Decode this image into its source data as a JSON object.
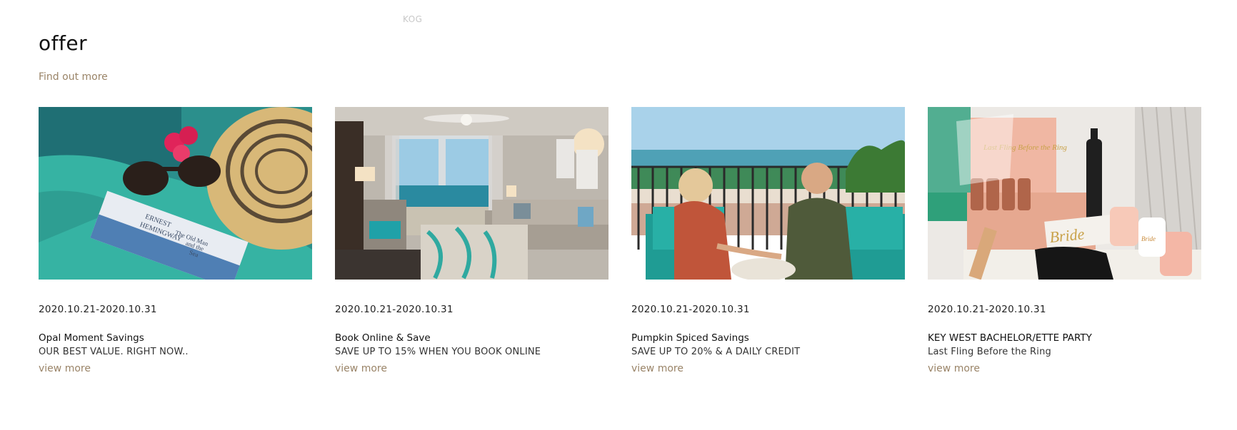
{
  "header": {
    "top_label": "KOG",
    "section_title": "offer",
    "find_more": "Find out more"
  },
  "offers": [
    {
      "date": "2020.10.21-2020.10.31",
      "title": "Opal Moment Savings",
      "subtitle": "OUR BEST VALUE. RIGHT NOW..",
      "view_more": "view more",
      "book_line1": "ERNEST",
      "book_line2": "HEMINGWAY",
      "book_line3": "The Old Man",
      "book_line4": "and the",
      "book_line5": "Sea"
    },
    {
      "date": "2020.10.21-2020.10.31",
      "title": "Book Online & Save",
      "subtitle": "SAVE UP TO 15% WHEN YOU BOOK ONLINE",
      "view_more": "view more"
    },
    {
      "date": "2020.10.21-2020.10.31",
      "title": "Pumpkin Spiced Savings",
      "subtitle": "SAVE UP TO 20% & A DAILY CREDIT",
      "view_more": "view more"
    },
    {
      "date": "2020.10.21-2020.10.31",
      "title": "KEY WEST BACHELOR/ETTE PARTY",
      "subtitle": "Last Fling Before the Ring",
      "view_more": "view more",
      "box_text": "Last Fling Before the Ring",
      "sign_text": "Bride",
      "cup_text": "Bride"
    }
  ],
  "colors": {
    "accent_link": "#9a8468",
    "teal": "#2fa9a0"
  }
}
